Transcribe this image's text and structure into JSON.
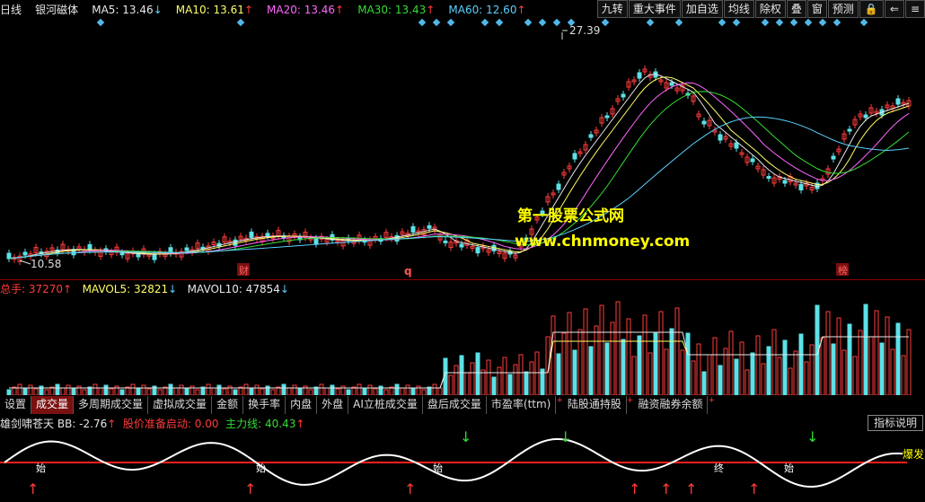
{
  "header": {
    "period": "日线",
    "stock_name": "银河磁体",
    "ma5": {
      "label": "MA5: 13.46",
      "color": "#e8e8e8",
      "dir": "down"
    },
    "ma10": {
      "label": "MA10: 13.61",
      "color": "#ffff66",
      "dir": "up"
    },
    "ma20": {
      "label": "MA20: 13.46",
      "color": "#ff66ff",
      "dir": "up"
    },
    "ma30": {
      "label": "MA30: 13.43",
      "color": "#33dd33",
      "dir": "up"
    },
    "ma60": {
      "label": "MA60: 12.60",
      "color": "#5ad0ff",
      "dir": "up"
    }
  },
  "toolbar": {
    "items": [
      "九转",
      "重大事件",
      "加自选",
      "均线",
      "除权",
      "叠",
      "窗",
      "预测"
    ],
    "lock_icon": "lock-icon",
    "back_icon": "back-arrow-icon",
    "menu_icon": "menu-icon"
  },
  "price_chart": {
    "high_label": "27.39",
    "low_label": "10.58",
    "marker_cai": "财",
    "marker_q": "q",
    "marker_bang": "榜"
  },
  "watermark": {
    "line1": "第一股票公式网",
    "line2": "www.chnmoney.com"
  },
  "volume": {
    "total": "总手: 37270",
    "mavol5": "MAVOL5: 32821",
    "mavol10": "MAVOL10: 47854"
  },
  "tabs": [
    "设置",
    "成交量",
    "多周期成交量",
    "虚拟成交量",
    "金额",
    "换手率",
    "内盘",
    "外盘",
    "AI立桩成交量",
    "盘后成交量",
    "市盈率(ttm)",
    "陆股通持股",
    "融资融券余额"
  ],
  "tabs_active": 1,
  "indicator": {
    "name": "雄剑啸苍天",
    "bb": "BB: -2.76",
    "signal": "股价准备启动: 0.00",
    "main_force": "主力线: 40.43",
    "button": "指标说明",
    "labels": {
      "shi": "始",
      "zhong": "终",
      "bao": "爆发"
    }
  },
  "colors": {
    "up": "#ff3b3b",
    "down": "#5ce1e6",
    "label_red": "#ff3b3b",
    "label_yellow": "#ffff00",
    "label_green": "#33dd33"
  }
}
